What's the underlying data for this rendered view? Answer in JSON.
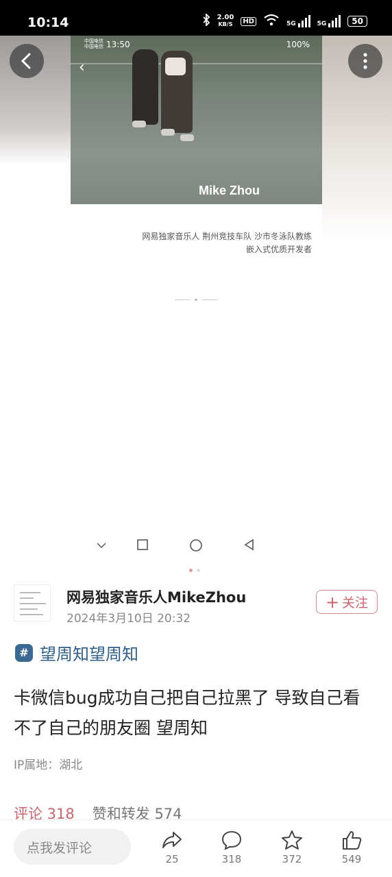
{
  "status_bar": {
    "time": "10:14",
    "speed_value": "2.00",
    "speed_unit": "KB/S",
    "hd": "HD",
    "net1": "5G",
    "net2": "5G",
    "battery": "50"
  },
  "media": {
    "inner_status": {
      "carrier": "中国电信\n中国电信",
      "time": "13:50",
      "battery": "100%"
    },
    "video_name": "Mike Zhou",
    "caption_line1": "网易独家音乐人 荆州竞技车队 沙市冬泳队教练",
    "caption_line2": "嵌入式优质开发者"
  },
  "post": {
    "author": "网易独家音乐人MikeZhou",
    "time": "2024年3月10日 20:32",
    "follow_label": "关注",
    "follow_plus": "+",
    "topic_symbol": "#",
    "topic": "望周知望周知",
    "body": "卡微信bug成功自己把自己拉黑了 导致自己看不了自己的朋友圈 望周知",
    "ip": "IP属地：湖北",
    "comments_label": "评论 318",
    "reposts_label": "赞和转发 574"
  },
  "bottom_bar": {
    "comment_placeholder": "点我发评论",
    "share_count": "25",
    "comment_count": "318",
    "favorite_count": "372",
    "like_count": "549"
  },
  "colors": {
    "accent": "#c8656f",
    "topic": "#2f5f86",
    "status_bg": "#000000"
  },
  "icons": [
    "bluetooth-icon",
    "wifi-icon",
    "signal-icon",
    "battery-icon",
    "back-icon",
    "more-icon",
    "share-icon",
    "comment-icon",
    "star-icon",
    "like-icon",
    "nav-back-icon",
    "nav-home-icon",
    "nav-recent-icon",
    "nav-down-icon"
  ]
}
